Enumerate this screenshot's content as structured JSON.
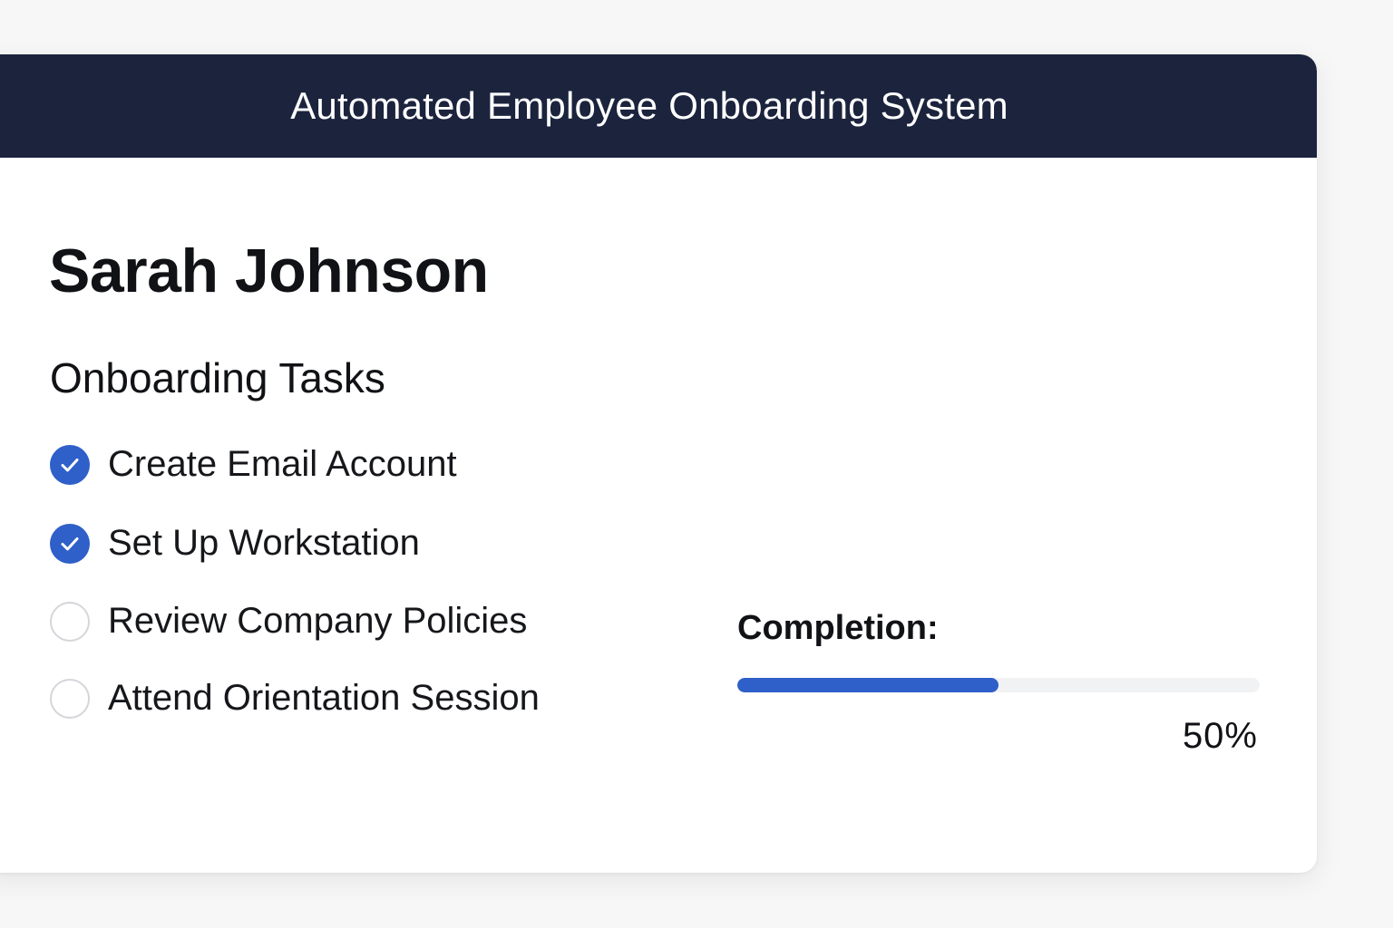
{
  "header": {
    "title": "Automated Employee Onboarding System"
  },
  "employee": {
    "name": "Sarah Johnson"
  },
  "tasks": {
    "heading": "Onboarding Tasks",
    "items": [
      {
        "label": "Create Email Account",
        "completed": true
      },
      {
        "label": "Set Up Workstation",
        "completed": true
      },
      {
        "label": "Review Company Policies",
        "completed": false
      },
      {
        "label": "Attend Orientation Session",
        "completed": false
      }
    ]
  },
  "completion": {
    "label": "Completion:",
    "percent": 50,
    "percent_text": "50%"
  },
  "colors": {
    "header_bg": "#1b233d",
    "accent": "#2f5fc8",
    "track": "#f1f2f4",
    "unchecked_border": "#d4d6da"
  },
  "icons": {
    "checked": "check-circle-icon",
    "unchecked": "empty-circle-icon"
  }
}
